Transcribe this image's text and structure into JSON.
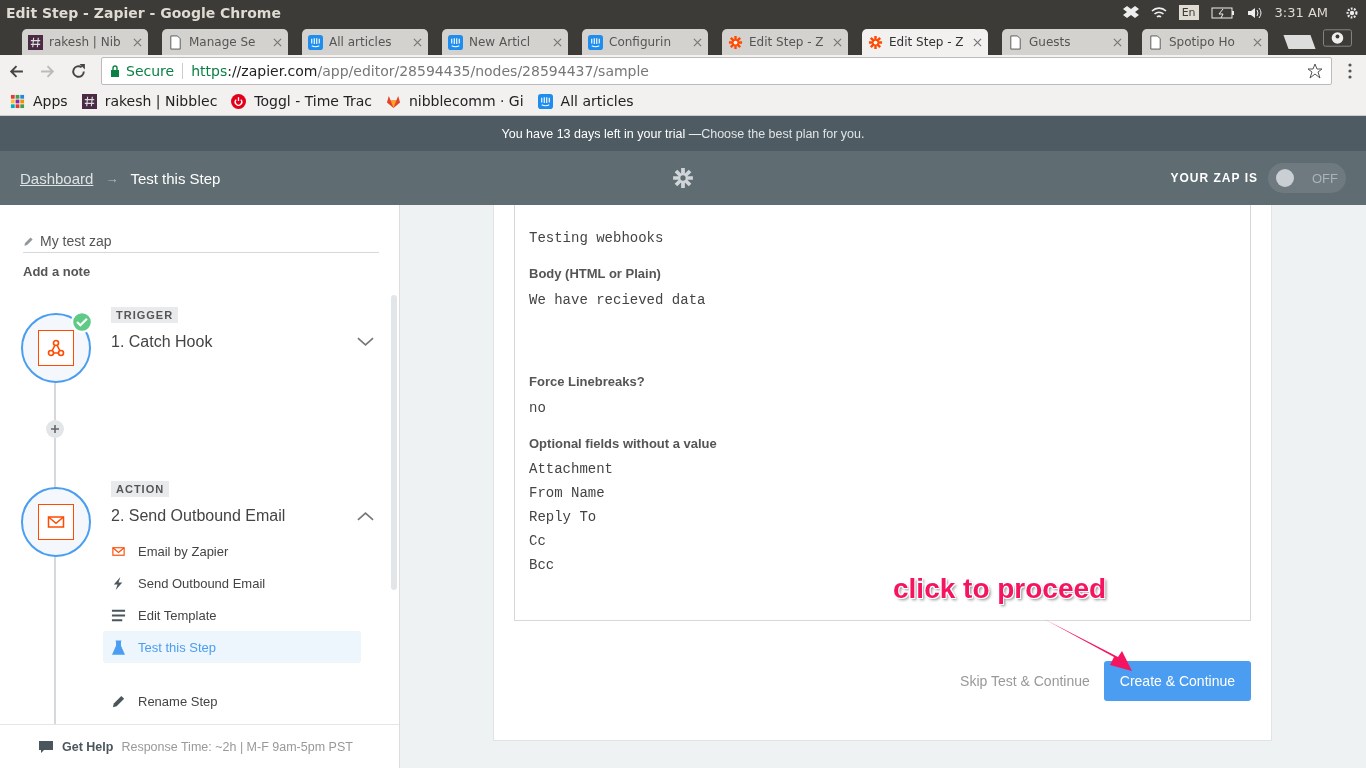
{
  "os_bar": {
    "title": "Edit Step - Zapier - Google Chrome",
    "keyboard": "En",
    "clock": "3:31 AM"
  },
  "tabs": [
    {
      "label": "rakesh | Nib",
      "kind": "hash",
      "selected": false
    },
    {
      "label": "Manage Se",
      "kind": "page",
      "selected": false
    },
    {
      "label": "All articles",
      "kind": "intercom",
      "selected": false
    },
    {
      "label": "New Articl",
      "kind": "intercom",
      "selected": false
    },
    {
      "label": "Configurin",
      "kind": "intercom",
      "selected": false
    },
    {
      "label": "Edit Step - Z",
      "kind": "zapier",
      "selected": false
    },
    {
      "label": "Edit Step - Z",
      "kind": "zapier",
      "selected": true
    },
    {
      "label": "Guests",
      "kind": "page",
      "selected": false
    },
    {
      "label": "Spotipo Ho",
      "kind": "page",
      "selected": false
    }
  ],
  "address_bar": {
    "secure_label": "Secure",
    "url_scheme": "https",
    "url_host": "://zapier.com",
    "url_path": "/app/editor/28594435/nodes/28594437/sample"
  },
  "bookmarks": [
    {
      "label": "Apps",
      "kind": "apps"
    },
    {
      "label": "rakesh | Nibblec",
      "kind": "hash"
    },
    {
      "label": "Toggl - Time Trac",
      "kind": "power"
    },
    {
      "label": "nibblecomm · Gi",
      "kind": "fox"
    },
    {
      "label": "All articles",
      "kind": "intercom"
    }
  ],
  "trial_banner": {
    "text": "You have 13 days left in your trial —",
    "link": "Choose the best plan for you."
  },
  "header": {
    "breadcrumb_link": "Dashboard",
    "separator": "→",
    "current": "Test this Step",
    "zap_status_label": "YOUR ZAP IS",
    "toggle": {
      "on": false,
      "label": "OFF"
    }
  },
  "sidebar": {
    "zap_name": "My test zap",
    "add_note": "Add a note",
    "steps": [
      {
        "badge": "TRIGGER",
        "title": "1. Catch Hook",
        "kind": "webhook",
        "done": true,
        "expanded": false
      },
      {
        "badge": "ACTION",
        "title": "2. Send Outbound Email",
        "kind": "email",
        "done": false,
        "expanded": true,
        "items": [
          {
            "label": "Email by Zapier",
            "kind": "email",
            "selected": false
          },
          {
            "label": "Send Outbound Email",
            "kind": "bolt",
            "selected": false
          },
          {
            "label": "Edit Template",
            "kind": "lines",
            "selected": false
          },
          {
            "label": "Test this Step",
            "kind": "flask",
            "selected": true
          }
        ],
        "extra_items": [
          {
            "label": "Rename Step",
            "kind": "pencil"
          }
        ]
      }
    ],
    "help": {
      "label": "Get Help",
      "detail": "Response Time: ~2h | M-F 9am-5pm PST"
    }
  },
  "sample": {
    "fields": [
      {
        "value": "Testing webhooks"
      },
      {
        "label": "Body (HTML or Plain)",
        "value": "We have recieved data",
        "kind": "multiline"
      },
      {
        "label": "Force Linebreaks?",
        "value": "no"
      }
    ],
    "optional_label": "Optional fields without a value",
    "optional_fields": [
      "Attachment",
      "From Name",
      "Reply To",
      "Cc",
      "Bcc"
    ]
  },
  "buttons": {
    "skip": "Skip Test & Continue",
    "primary": "Create & Continue"
  },
  "annotation": {
    "text": "click to proceed"
  }
}
